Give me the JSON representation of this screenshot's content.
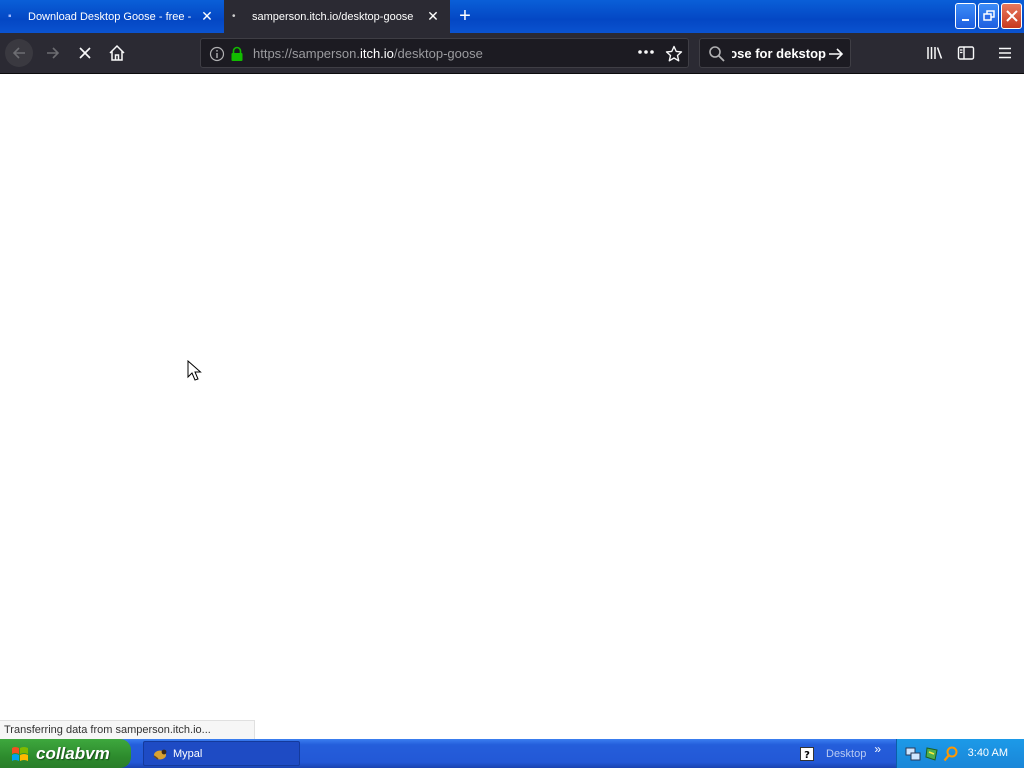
{
  "tabs": [
    {
      "title": "Download Desktop Goose - free - D",
      "active": false
    },
    {
      "title": "samperson.itch.io/desktop-goose",
      "active": true
    }
  ],
  "toolbar": {
    "url_prefix": "https://samperson.",
    "url_domain": "itch.io",
    "url_path": "/desktop-goose",
    "search_value": "goose for dekstop"
  },
  "status_text": "Transferring data from samperson.itch.io...",
  "taskbar": {
    "start_label": "collabvm",
    "task_label": "Mypal",
    "desktop_label": "Desktop",
    "more_label": "»",
    "clock": "3:40 AM"
  },
  "colors": {
    "tab_active_bg": "#2b2a33",
    "toolbar_bg": "#2b2a33",
    "lock_green": "#12bc00",
    "taskbar_blue": "#245edb",
    "start_green": "#2d8c2d"
  }
}
